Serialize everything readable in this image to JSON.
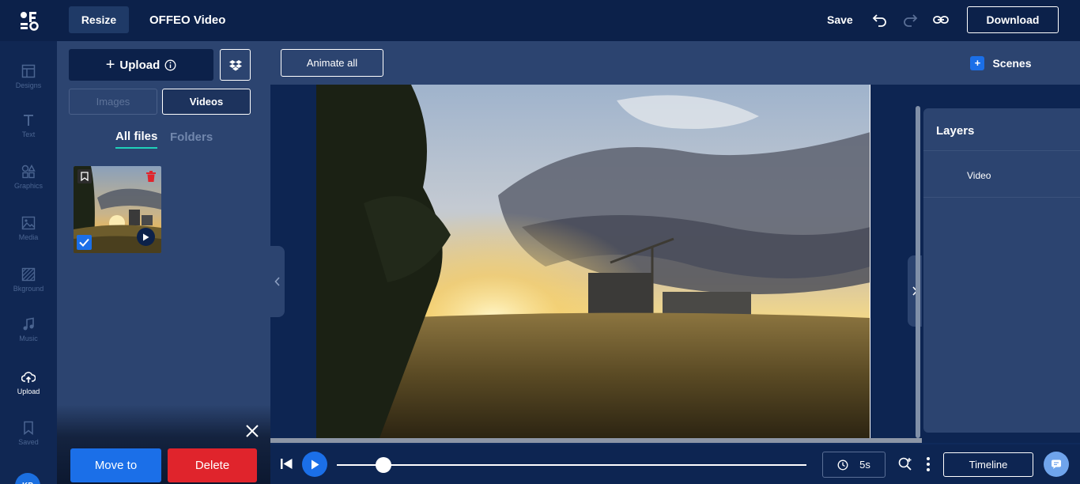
{
  "header": {
    "resize_label": "Resize",
    "title": "OFFEO Video",
    "save_label": "Save",
    "download_label": "Download",
    "icons": [
      "undo-icon",
      "redo-icon",
      "link-icon"
    ]
  },
  "rail": {
    "items": [
      {
        "label": "Designs",
        "icon": "layout-icon",
        "active": false
      },
      {
        "label": "Text",
        "icon": "text-icon",
        "active": false
      },
      {
        "label": "Graphics",
        "icon": "shapes-icon",
        "active": false
      },
      {
        "label": "Media",
        "icon": "image-icon",
        "active": false
      },
      {
        "label": "Bkground",
        "icon": "pattern-icon",
        "active": false
      },
      {
        "label": "Music",
        "icon": "music-icon",
        "active": false
      },
      {
        "label": "Upload",
        "icon": "cloud-upload-icon",
        "active": true
      },
      {
        "label": "Saved",
        "icon": "bookmark-icon",
        "active": false
      }
    ],
    "avatar_initials": "KP"
  },
  "panel": {
    "upload_label": "Upload",
    "filter_images": "Images",
    "filter_videos": "Videos",
    "tab_all": "All files",
    "tab_folders": "Folders",
    "move_label": "Move to",
    "delete_label": "Delete"
  },
  "canvas": {
    "animate_label": "Animate all"
  },
  "right": {
    "scenes_label": "Scenes",
    "layers_title": "Layers",
    "layer_items": [
      "Video"
    ]
  },
  "timeline": {
    "progress": 0.1,
    "duration": "5s",
    "timeline_label": "Timeline"
  },
  "colors": {
    "accent_blue": "#1b6fe8",
    "danger_red": "#e0242c",
    "tab_underline": "#1fd1b9",
    "nav_bg": "#0c214a",
    "panel_bg": "#2c4470"
  }
}
